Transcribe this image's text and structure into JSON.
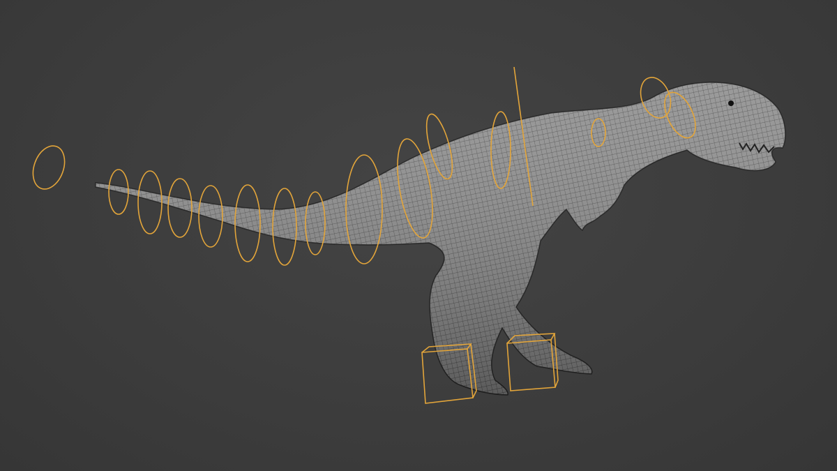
{
  "scene": {
    "subject": "t-rex-wireframe-rig",
    "colors": {
      "background": "#3d3d3d",
      "mesh": "#8a8a8a",
      "wire": "#2a2a2a",
      "rig_control": "#e3a53a"
    }
  }
}
